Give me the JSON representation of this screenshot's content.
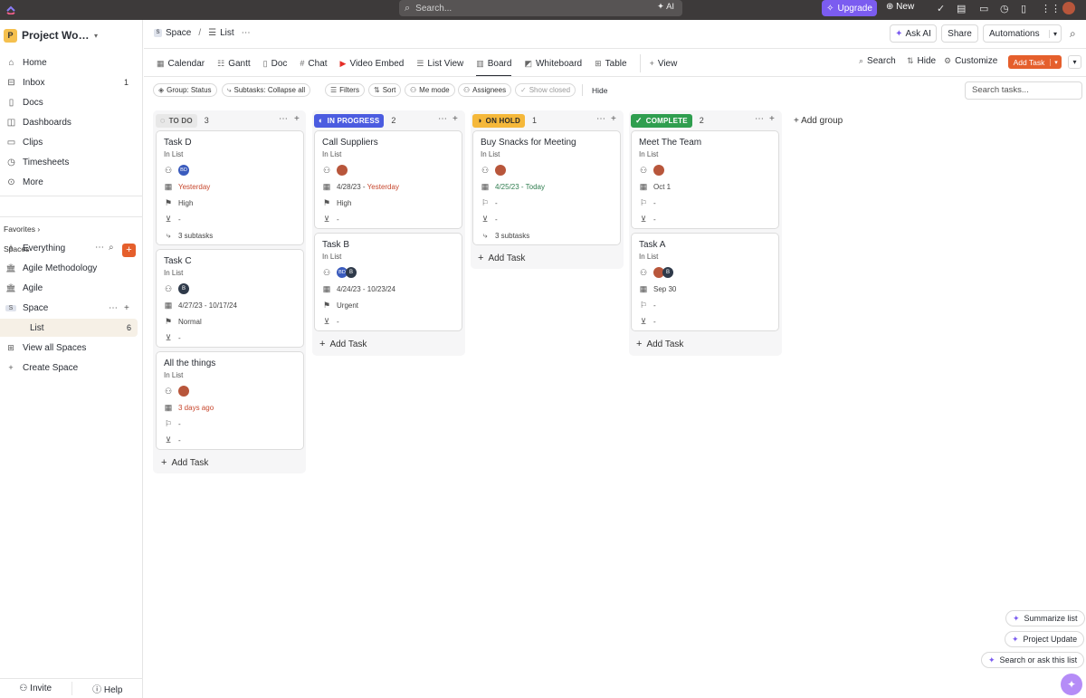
{
  "topbar": {
    "search_placeholder": "Search...",
    "ai_label": "AI",
    "upgrade_label": "Upgrade",
    "new_label": "New"
  },
  "sidebar": {
    "workspace_badge": "P",
    "workspace_name": "Project Workspace",
    "nav": [
      {
        "label": "Home"
      },
      {
        "label": "Inbox",
        "count": "1"
      },
      {
        "label": "Docs"
      },
      {
        "label": "Dashboards"
      },
      {
        "label": "Clips"
      },
      {
        "label": "Timesheets"
      },
      {
        "label": "More"
      }
    ],
    "favorites_label": "Favorites",
    "spaces_label": "Spaces",
    "tree": [
      {
        "label": "Everything"
      },
      {
        "label": "Agile Methodology"
      },
      {
        "label": "Agile"
      },
      {
        "label": "Space"
      },
      {
        "label": "List",
        "count": "6"
      },
      {
        "label": "View all Spaces"
      },
      {
        "label": "Create Space"
      }
    ],
    "footer": {
      "invite": "Invite",
      "help": "Help"
    }
  },
  "breadcrumb": {
    "space": "Space",
    "sep": "/",
    "list": "List"
  },
  "header_buttons": {
    "ask_ai": "Ask AI",
    "share": "Share",
    "automations": "Automations"
  },
  "tabs": [
    "Calendar",
    "Gantt",
    "Doc",
    "Chat",
    "Video Embed",
    "List View",
    "Board",
    "Whiteboard",
    "Table"
  ],
  "view_label": "View",
  "toolbar_right": {
    "search": "Search",
    "hide": "Hide",
    "customize": "Customize",
    "add_task": "Add Task"
  },
  "filters": {
    "group": "Group: Status",
    "subtasks": "Subtasks: Collapse all",
    "filters": "Filters",
    "sort": "Sort",
    "me_mode": "Me mode",
    "assignees": "Assignees",
    "show_closed": "Show closed",
    "hide": "Hide",
    "search_placeholder": "Search tasks..."
  },
  "columns": [
    {
      "status": "TO DO",
      "count": "3",
      "color": "#e8e8e8"
    },
    {
      "status": "IN PROGRESS",
      "count": "2",
      "color": "#4b5ce0"
    },
    {
      "status": "ON HOLD",
      "count": "1",
      "color": "#f5b83a"
    },
    {
      "status": "COMPLETE",
      "count": "2",
      "color": "#2f9e4f"
    }
  ],
  "cards": {
    "task_d": {
      "title": "Task D",
      "list": "In List",
      "date": "Yesterday",
      "priority": "High",
      "tags": "-",
      "subtasks": "3 subtasks",
      "av": "BD"
    },
    "task_c": {
      "title": "Task C",
      "list": "In List",
      "date": "4/27/23 - 10/17/24",
      "priority": "Normal",
      "tags": "-",
      "av": "B"
    },
    "all_things": {
      "title": "All the things",
      "list": "In List",
      "date": "3 days ago",
      "priority": "-",
      "tags": "-"
    },
    "call_suppliers": {
      "title": "Call Suppliers",
      "list": "In List",
      "date_start": "4/28/23",
      "date_sep": " - ",
      "date_end": "Yesterday",
      "priority": "High",
      "tags": "-"
    },
    "task_b": {
      "title": "Task B",
      "list": "In List",
      "date": "4/24/23 - 10/23/24",
      "priority": "Urgent",
      "tags": "-",
      "av1": "BD",
      "av2": "B"
    },
    "buy_snacks": {
      "title": "Buy Snacks for Meeting",
      "list": "In List",
      "date": "4/25/23 - Today",
      "priority": "-",
      "tags": "-",
      "subtasks": "3 subtasks"
    },
    "meet_team": {
      "title": "Meet The Team",
      "list": "In List",
      "date": "Oct 1",
      "priority": "-",
      "tags": "-"
    },
    "task_a": {
      "title": "Task A",
      "list": "In List",
      "date": "Sep 30",
      "priority": "-",
      "tags": "-",
      "av2": "B"
    }
  },
  "add_task_label": "Add Task",
  "add_group_label": "Add group",
  "ai_chips": {
    "summarize": "Summarize list",
    "project_update": "Project Update",
    "search_ask": "Search or ask this list"
  }
}
